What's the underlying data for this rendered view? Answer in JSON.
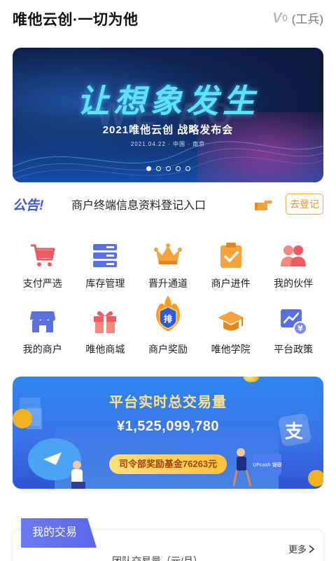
{
  "header": {
    "title": "唯他云创·一切为他",
    "level_letter": "V",
    "level_number": "0",
    "role": "(工兵)"
  },
  "banner": {
    "headline": "让想象发生",
    "subline": "2021唯他云创 战略发布会",
    "meta": "2021.04.22 · 中国 · 南京",
    "bg_letters": "WE   AO",
    "slide_count": 5,
    "active_slide": 1
  },
  "notice": {
    "tag": "公告!",
    "text": "商户终端信息资料登记入口",
    "button_label": "去登记"
  },
  "grid": [
    [
      {
        "label": "支付严选",
        "icon": "cart-icon"
      },
      {
        "label": "库存管理",
        "icon": "server-icon"
      },
      {
        "label": "晋升通道",
        "icon": "crown-icon"
      },
      {
        "label": "商户进件",
        "icon": "clipboard-check-icon"
      },
      {
        "label": "我的伙伴",
        "icon": "people-icon"
      }
    ],
    [
      {
        "label": "我的商户",
        "icon": "store-icon"
      },
      {
        "label": "唯他商城",
        "icon": "gift-icon"
      },
      {
        "label": "商户奖励",
        "icon": "rank-badge-icon",
        "badge_text": "排"
      },
      {
        "label": "唯他学院",
        "icon": "graduation-cap-icon"
      },
      {
        "label": "平台政策",
        "icon": "policy-chart-icon"
      }
    ]
  ],
  "stats": {
    "title": "平台实时总交易量",
    "amount": "¥1,525,099,780",
    "fund": "司令部奖励基金76263元",
    "alipay_glyph": "支",
    "unionpay_text": "UPcash 银联"
  },
  "transactions": {
    "tab_label": "我的交易",
    "more_label": "更多",
    "sub_label": "团队交易量（元/月）"
  },
  "colors": {
    "notice_tag": "#3d5bd9",
    "register_border": "#f1a64a",
    "stats_title": "#ffe38a",
    "tab_bg": "#5a66e6"
  }
}
